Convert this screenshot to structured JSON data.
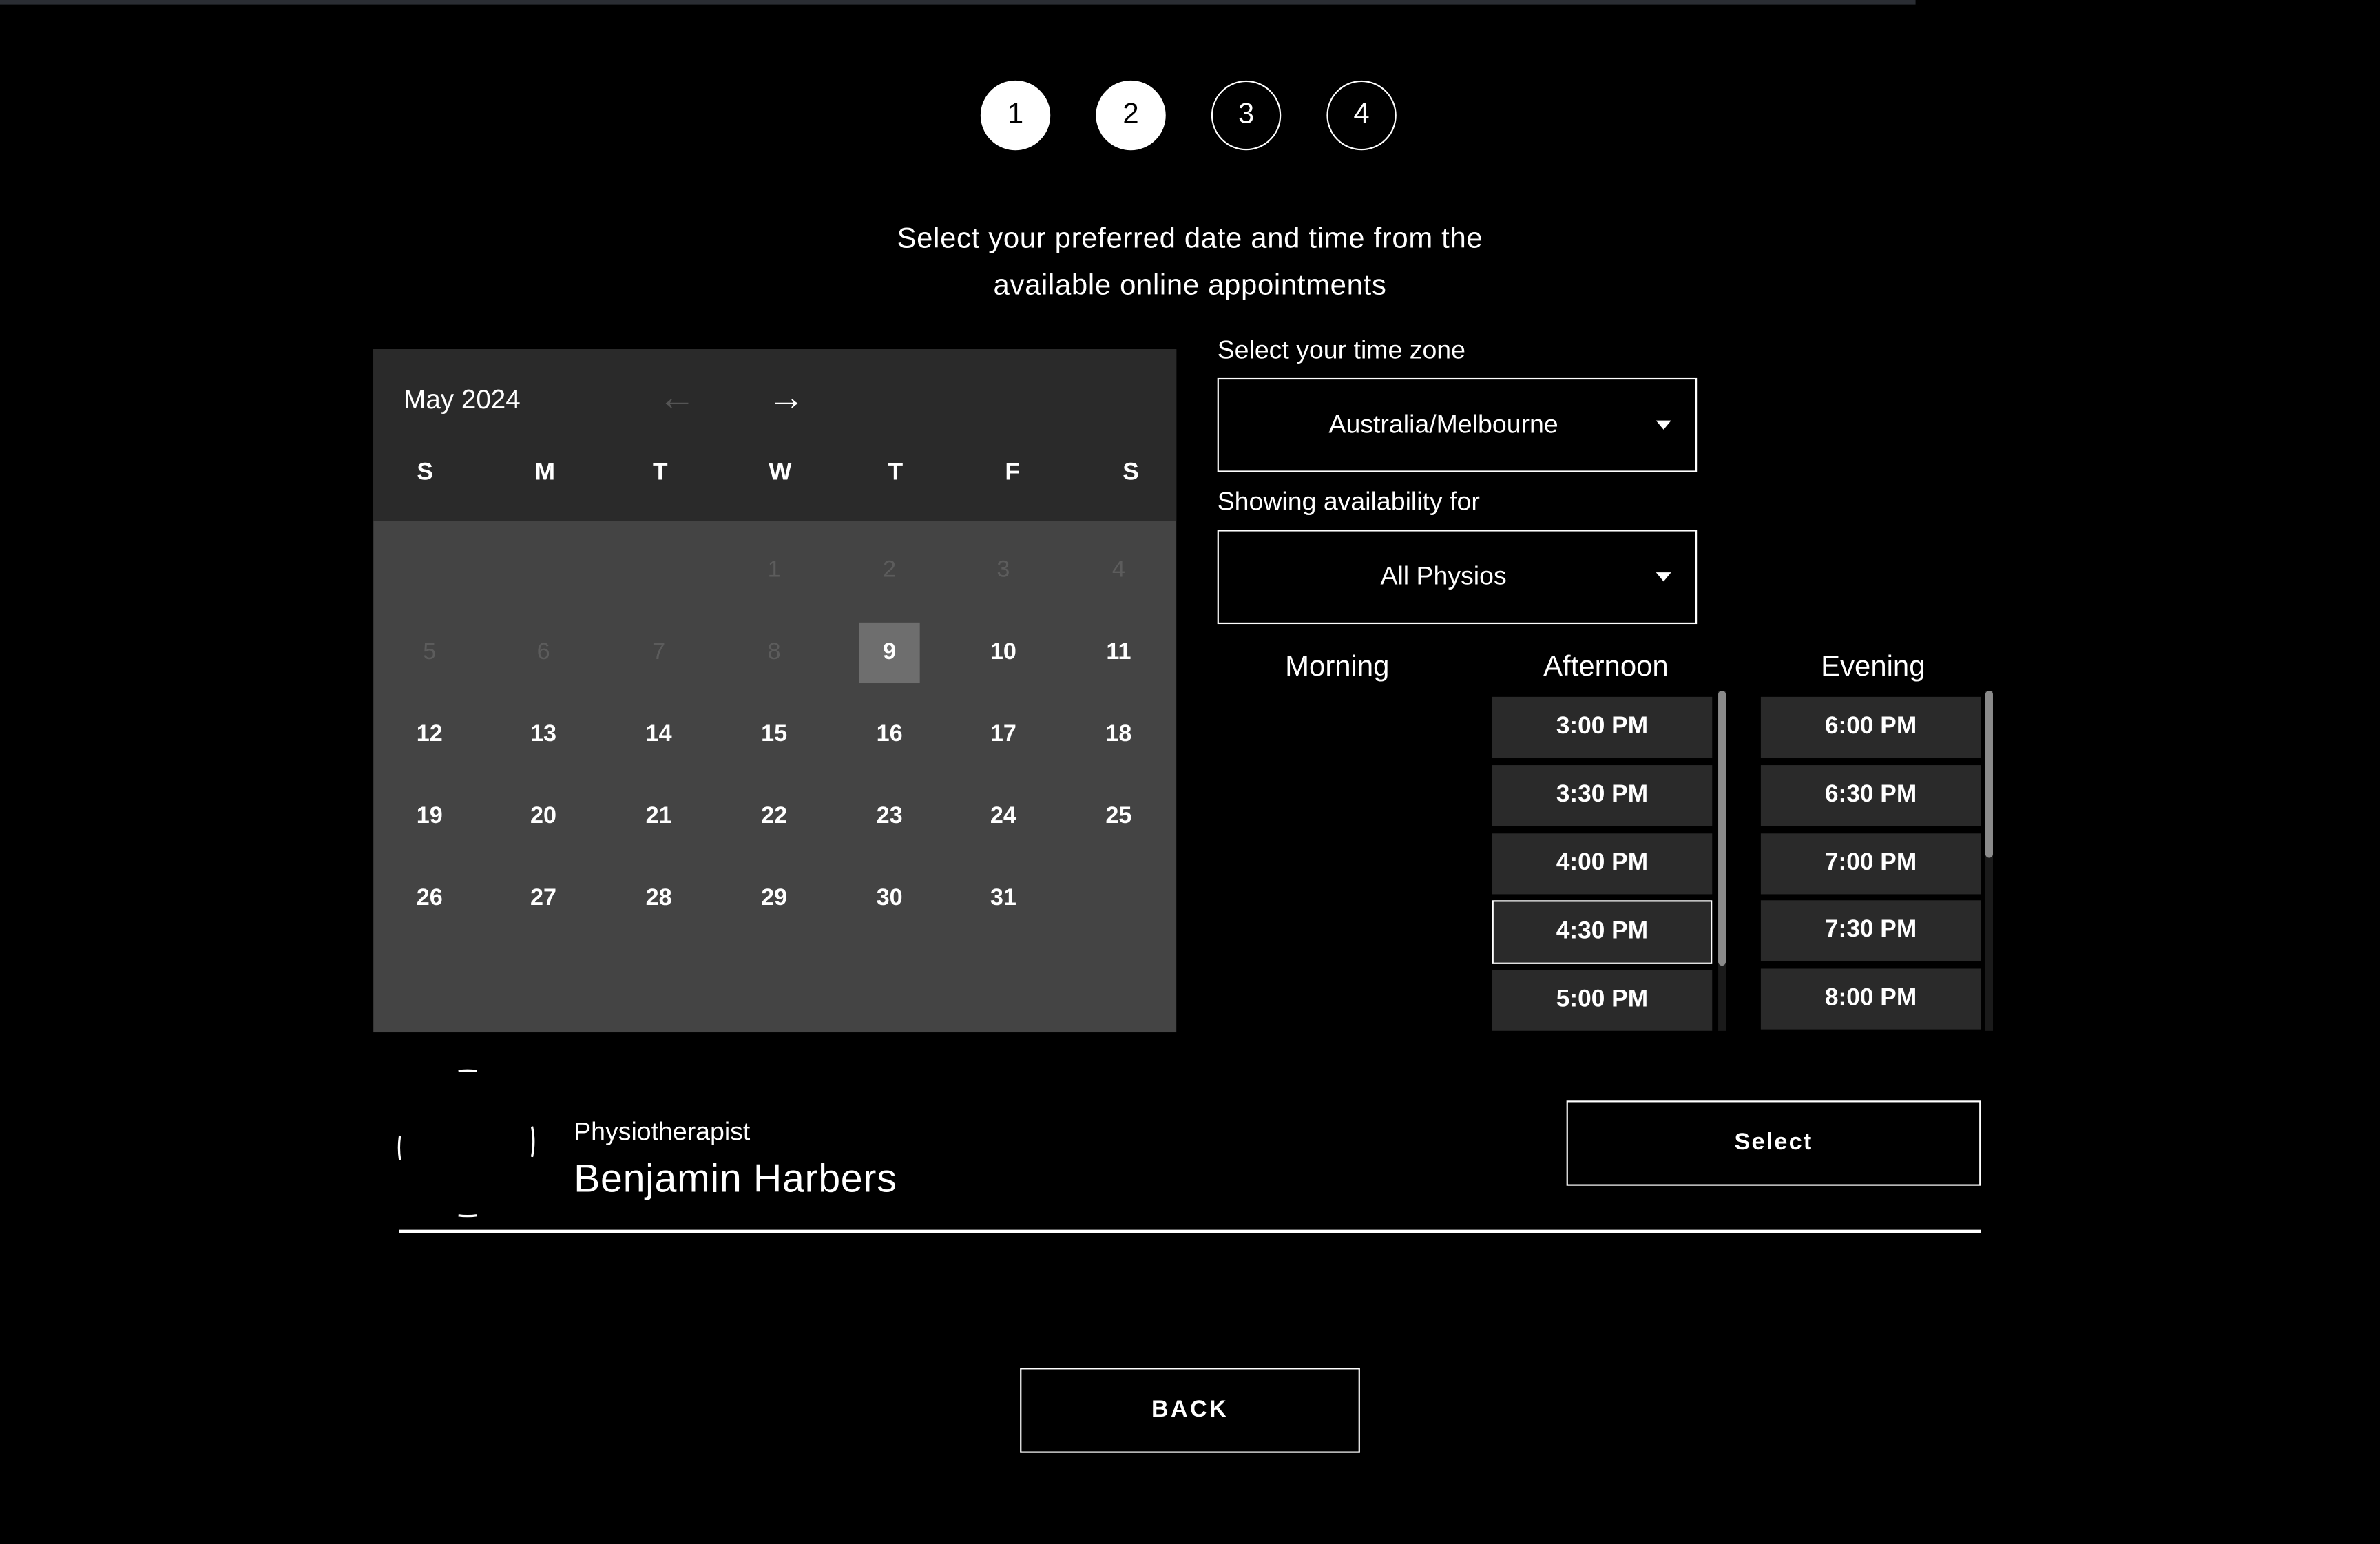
{
  "stepper": {
    "steps": [
      {
        "label": "1",
        "state": "done"
      },
      {
        "label": "2",
        "state": "done"
      },
      {
        "label": "3",
        "state": "todo"
      },
      {
        "label": "4",
        "state": "todo"
      }
    ]
  },
  "intro": {
    "line1": "Select your preferred date and time from the",
    "line2": "available online appointments"
  },
  "calendar": {
    "month_label": "May 2024",
    "prev_icon": "arrow-left-icon",
    "next_icon": "arrow-right-icon",
    "weekdays": [
      "S",
      "M",
      "T",
      "W",
      "T",
      "F",
      "S"
    ],
    "weeks": [
      [
        "",
        "",
        "",
        "1",
        "2",
        "3",
        "4"
      ],
      [
        "5",
        "6",
        "7",
        "8",
        "9",
        "10",
        "11"
      ],
      [
        "12",
        "13",
        "14",
        "15",
        "16",
        "17",
        "18"
      ],
      [
        "19",
        "20",
        "21",
        "22",
        "23",
        "24",
        "25"
      ],
      [
        "26",
        "27",
        "28",
        "29",
        "30",
        "31",
        ""
      ]
    ],
    "disabled_days": [
      "1",
      "2",
      "3",
      "4",
      "5",
      "6",
      "7",
      "8"
    ],
    "selected_day": "9"
  },
  "timezone": {
    "label": "Select your time zone",
    "value": "Australia/Melbourne"
  },
  "availability": {
    "label": "Showing availability for",
    "value": "All Physios"
  },
  "slots": {
    "morning": {
      "heading": "Morning",
      "times": []
    },
    "afternoon": {
      "heading": "Afternoon",
      "times": [
        "3:00 PM",
        "3:30 PM",
        "4:00 PM",
        "4:30 PM",
        "5:00 PM"
      ]
    },
    "evening": {
      "heading": "Evening",
      "times": [
        "6:00 PM",
        "6:30 PM",
        "7:00 PM",
        "7:30 PM",
        "8:00 PM"
      ]
    },
    "active_time": "4:30 PM"
  },
  "physio": {
    "role": "Physiotherapist",
    "name": "Benjamin Harbers",
    "select_label": "Select"
  },
  "back_label": "BACK",
  "colors": {
    "background": "#000000",
    "calendar_header": "#2a2a2a",
    "calendar_body": "#444444",
    "selected_day": "#6e6e6e",
    "slot": "#2a2a2a"
  }
}
